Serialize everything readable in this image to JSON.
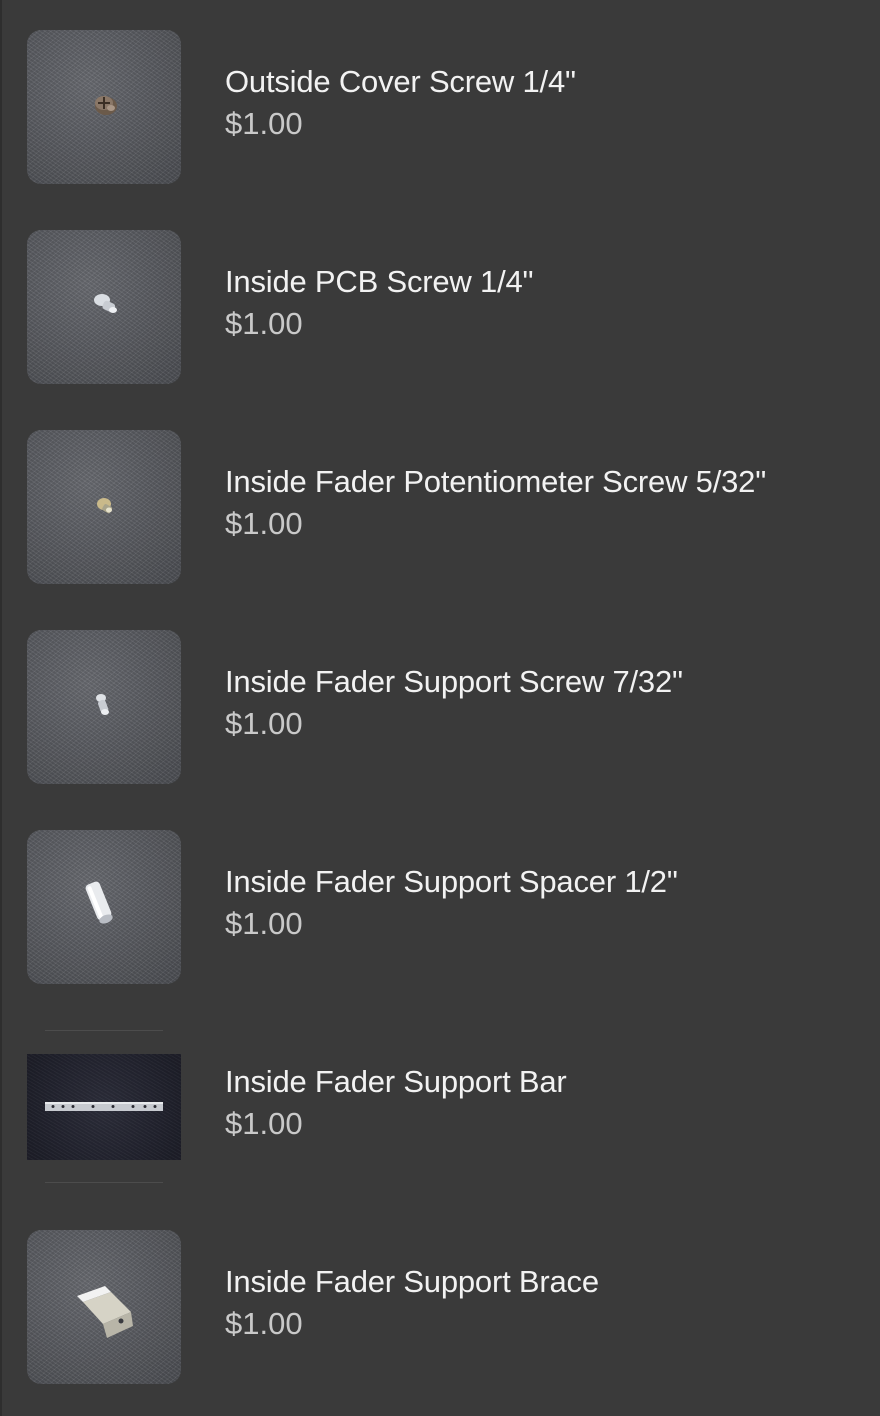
{
  "items": [
    {
      "title": "Outside Cover Screw 1/4\"",
      "price": "$1.00",
      "image": "outside-cover-screw-photo"
    },
    {
      "title": "Inside PCB Screw 1/4\"",
      "price": "$1.00",
      "image": "inside-pcb-screw-photo"
    },
    {
      "title": "Inside Fader Potentiometer Screw 5/32\"",
      "price": "$1.00",
      "image": "fader-potentiometer-screw-photo"
    },
    {
      "title": "Inside Fader Support Screw 7/32\"",
      "price": "$1.00",
      "image": "fader-support-screw-photo"
    },
    {
      "title": "Inside Fader Support Spacer 1/2\"",
      "price": "$1.00",
      "image": "fader-support-spacer-photo"
    },
    {
      "title": "Inside Fader Support Bar",
      "price": "$1.00",
      "image": "fader-support-bar-photo"
    },
    {
      "title": "Inside Fader Support Brace",
      "price": "$1.00",
      "image": "fader-support-brace-photo"
    }
  ]
}
